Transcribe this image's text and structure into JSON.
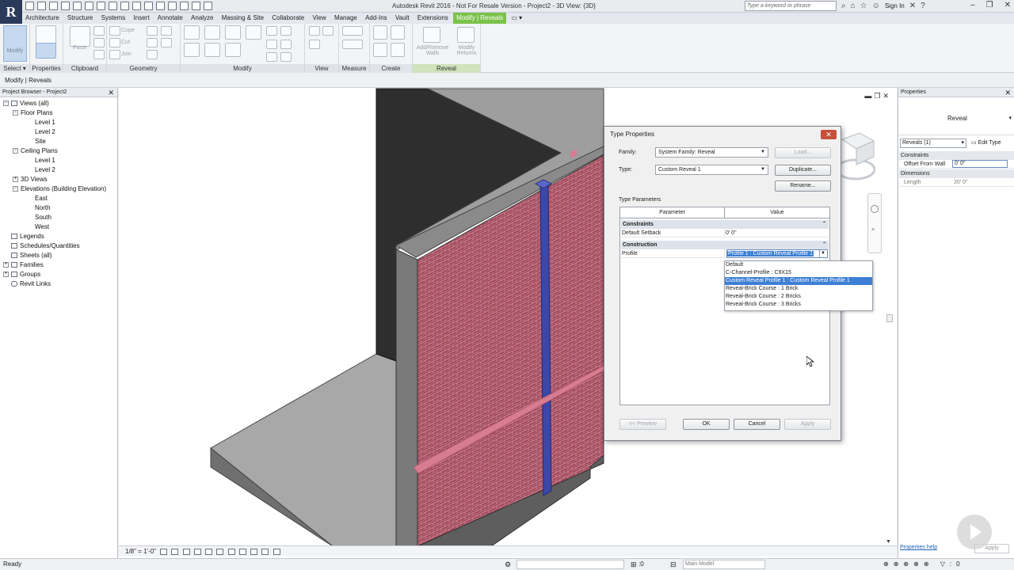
{
  "app": {
    "title": "Autodesk Revit 2016 - Not For Resale Version -    Project2 - 3D View: {3D}",
    "logo_letter": "R",
    "search_placeholder": "Type a keyword or phrase",
    "sign_in": "Sign In"
  },
  "menu_tabs": [
    "Architecture",
    "Structure",
    "Systems",
    "Insert",
    "Annotate",
    "Analyze",
    "Massing & Site",
    "Collaborate",
    "View",
    "Manage",
    "Add-Ins",
    "Vault",
    "Extensions",
    "Modify | Reveals"
  ],
  "ribbon": {
    "modify_label": "Modify",
    "paste_label": "Paste",
    "cope_label": "Cope",
    "cut_label": "Cut",
    "join_label": "Join",
    "add_remove_walls_label": "Add/Remove Walls",
    "modify_returns_label": "Modify Returns",
    "panels": [
      "Select",
      "Properties",
      "Clipboard",
      "Geometry",
      "Modify",
      "View",
      "Measure",
      "Create",
      "Reveal"
    ]
  },
  "options_bar": "Modify | Reveals",
  "project_browser": {
    "title": "Project Browser - Project2",
    "items": [
      {
        "label": "Views (all)",
        "toggle": "−"
      },
      {
        "label": "Floor Plans",
        "toggle": "−"
      },
      {
        "label": "Level 1",
        "toggle": ""
      },
      {
        "label": "Level 2",
        "toggle": ""
      },
      {
        "label": "Site",
        "toggle": ""
      },
      {
        "label": "Ceiling Plans",
        "toggle": "−"
      },
      {
        "label": "Level 1",
        "toggle": ""
      },
      {
        "label": "Level 2",
        "toggle": ""
      },
      {
        "label": "3D Views",
        "toggle": "+"
      },
      {
        "label": "Elevations (Building Elevation)",
        "toggle": "−"
      },
      {
        "label": "East",
        "toggle": ""
      },
      {
        "label": "North",
        "toggle": ""
      },
      {
        "label": "South",
        "toggle": ""
      },
      {
        "label": "West",
        "toggle": ""
      },
      {
        "label": "Legends",
        "toggle": ""
      },
      {
        "label": "Schedules/Quantities",
        "toggle": ""
      },
      {
        "label": "Sheets (all)",
        "toggle": ""
      },
      {
        "label": "Families",
        "toggle": "+"
      },
      {
        "label": "Groups",
        "toggle": "+"
      },
      {
        "label": "Revit Links",
        "toggle": ""
      }
    ]
  },
  "view_bar": {
    "scale": "1/8\" = 1'-0\""
  },
  "properties": {
    "title": "Properties",
    "type_name": "Reveal",
    "filter": "Reveals (1)",
    "edit_type": "Edit Type",
    "categories": [
      {
        "name": "Constraints",
        "rows": [
          {
            "k": "Offset From Wall",
            "v": "0'  0\""
          }
        ]
      },
      {
        "name": "Dimensions",
        "rows": [
          {
            "k": "Length",
            "v": "20'  0\""
          }
        ]
      }
    ],
    "help": "Properties help",
    "apply": "Apply"
  },
  "status": {
    "ready": "Ready",
    "zero": ":0",
    "model": "Main Model"
  },
  "dialog": {
    "title": "Type Properties",
    "family_label": "Family:",
    "family_value": "System Family: Reveal",
    "type_label": "Type:",
    "type_value": "Custom Reveal 1",
    "load": "Load...",
    "duplicate": "Duplicate...",
    "rename": "Rename...",
    "type_parameters": "Type Parameters",
    "col_parameter": "Parameter",
    "col_value": "Value",
    "constraints": "Constraints",
    "default_setback_label": "Default Setback",
    "default_setback_value": "0'  0\"",
    "construction": "Construction",
    "profile_label": "Profile",
    "profile_value": "Profile 1 : Custom Reveal Profile 1",
    "profile_options": [
      "Default",
      "C-Channel-Profile : C9X15",
      "Custom Reveal Profile 1 : Custom Reveal Profile 1",
      "Reveal-Brick Course : 1 Brick",
      "Reveal-Brick Course : 2 Bricks",
      "Reveal-Brick Course : 3 Bricks"
    ],
    "selected_option_index": 2,
    "preview": "<< Preview",
    "ok": "OK",
    "cancel": "Cancel",
    "apply": "Apply"
  },
  "colors": {
    "accent": "#7bc24b",
    "selection": "#3d7fd5",
    "brick": "#a24a5c",
    "reveal": "#3c47a8"
  }
}
